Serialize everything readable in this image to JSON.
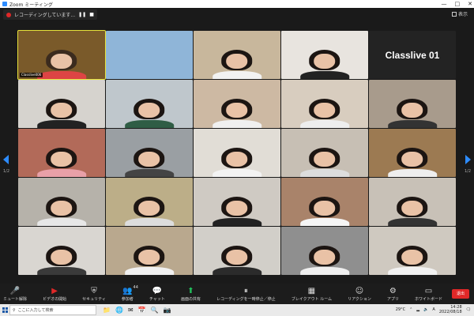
{
  "window": {
    "title": "Zoom ミーティング",
    "controls": [
      "—",
      "□",
      "✕"
    ]
  },
  "recording": {
    "text": "レコーディングしています...",
    "pause_icon": "pause-icon",
    "stop_icon": "stop-icon"
  },
  "view": {
    "label": "表示"
  },
  "pages": {
    "left": "1/2",
    "right": "1/2"
  },
  "tiles": [
    {
      "name": "Classlive006",
      "bg": "#7a5a2a",
      "active": true,
      "hair": "#3b2b1e",
      "shirt": "#d44"
    },
    {
      "name": "",
      "bg": "#8fb5d8",
      "hair": "",
      "shirt": ""
    },
    {
      "name": "",
      "bg": "#c8b79c",
      "hair": "#1c1512",
      "shirt": "#f2f2f2"
    },
    {
      "name": "",
      "bg": "#e8e4df",
      "hair": "#1c1512",
      "shirt": "#222"
    },
    {
      "name": "Classlive 01",
      "label": true
    },
    {
      "name": "",
      "bg": "#d6d3ce",
      "hair": "#1c1512",
      "shirt": "#222"
    },
    {
      "name": "",
      "bg": "#bfc7cc",
      "hair": "#1c1512",
      "shirt": "#2f5d45"
    },
    {
      "name": "",
      "bg": "#cdb9a3",
      "hair": "#1c1512",
      "shirt": "#f0f0f0"
    },
    {
      "name": "",
      "bg": "#d8cdbf",
      "hair": "#1c1512",
      "shirt": "#eee"
    },
    {
      "name": "",
      "bg": "#a89b8c",
      "hair": "#1c1512",
      "shirt": "#333"
    },
    {
      "name": "",
      "bg": "#b26a59",
      "hair": "#1c1512",
      "shirt": "#e8a0a8"
    },
    {
      "name": "",
      "bg": "#9a9fa3",
      "hair": "#1c1512",
      "shirt": "#444"
    },
    {
      "name": "",
      "bg": "#e1ddd6",
      "hair": "#1c1512",
      "shirt": "#f3f3f3"
    },
    {
      "name": "",
      "bg": "#c7bfb4",
      "hair": "#1c1512",
      "shirt": "#ddd"
    },
    {
      "name": "",
      "bg": "#9c7a52",
      "hair": "#1c1512",
      "shirt": "#eee"
    },
    {
      "name": "",
      "bg": "#b6b2aa",
      "hair": "#1c1512",
      "shirt": "#e7e7e7"
    },
    {
      "name": "",
      "bg": "#bcae88",
      "hair": "#1c1512",
      "shirt": "#ddd"
    },
    {
      "name": "",
      "bg": "#cfcac3",
      "hair": "#1c1512",
      "shirt": "#222"
    },
    {
      "name": "",
      "bg": "#a9836a",
      "hair": "#1c1512",
      "shirt": "#f5f5f5"
    },
    {
      "name": "",
      "bg": "#c8c1b7",
      "hair": "#1c1512",
      "shirt": "#333"
    },
    {
      "name": "",
      "bg": "#d9d6d1",
      "hair": "#1c1512",
      "shirt": "#3a3a3a"
    },
    {
      "name": "",
      "bg": "#b9a88e",
      "hair": "#1c1512",
      "shirt": "#f0f0f0"
    },
    {
      "name": "",
      "bg": "#d2cfc9",
      "hair": "#1c1512",
      "shirt": "#2b2b2b"
    },
    {
      "name": "",
      "bg": "#8f8f8f",
      "hair": "#1c1512",
      "shirt": "#efefef"
    },
    {
      "name": "",
      "bg": "#cfc9c0",
      "hair": "#1c1512",
      "shirt": "#f1f1f1"
    }
  ],
  "toolbar": {
    "items": [
      {
        "label": "ミュート解除",
        "icon": "microphone-muted-icon",
        "glyph": "🎤",
        "tone": "red"
      },
      {
        "label": "ビデオの開始",
        "icon": "video-off-icon",
        "glyph": "▶",
        "tone": "red"
      },
      {
        "label": "セキュリティ",
        "icon": "shield-icon",
        "glyph": "⛨",
        "tone": ""
      },
      {
        "label": "参加者",
        "icon": "participants-icon",
        "glyph": "👥",
        "tone": "",
        "badge": "44"
      },
      {
        "label": "チャット",
        "icon": "chat-icon",
        "glyph": "💬",
        "tone": ""
      },
      {
        "label": "画面の共有",
        "icon": "share-screen-icon",
        "glyph": "⬆",
        "tone": "green"
      },
      {
        "label": "レコーディングを一時停止／停止",
        "icon": "record-icon",
        "glyph": "⏸",
        "tone": ""
      },
      {
        "label": "ブレイクアウト ルーム",
        "icon": "breakout-rooms-icon",
        "glyph": "▦",
        "tone": ""
      },
      {
        "label": "リアクション",
        "icon": "reaction-icon",
        "glyph": "☺",
        "tone": ""
      },
      {
        "label": "アプリ",
        "icon": "apps-icon",
        "glyph": "⚙",
        "tone": ""
      },
      {
        "label": "ホワイトボード",
        "icon": "whiteboard-icon",
        "glyph": "▭",
        "tone": ""
      }
    ],
    "end": "退出"
  },
  "taskbar": {
    "search_placeholder": "ここに入力して検索",
    "apps": [
      "📁",
      "🌐",
      "✉",
      "📅",
      "🔍",
      "📷"
    ],
    "weather": "29°C",
    "ime": "A",
    "time": "14:28",
    "date": "2022/08/18"
  }
}
